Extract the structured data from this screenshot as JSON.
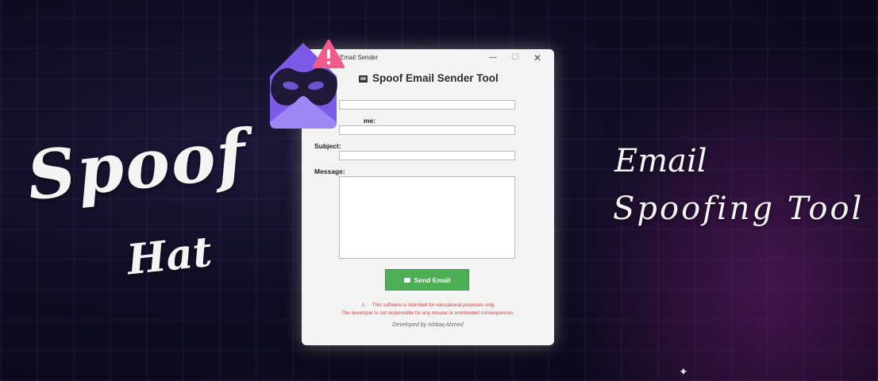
{
  "banner": {
    "brand_line1": "Spoof",
    "brand_line2": "Hat",
    "tagline_line1": "Email",
    "tagline_line2": "Spoofing Tool"
  },
  "window": {
    "title": "Email Sender",
    "minimize_glyph": "—",
    "maximize_glyph": "☐",
    "close_glyph": "✕",
    "app_title": "Spoof Email Sender Tool",
    "fields": {
      "from_name_label": "me:",
      "subject_label": "Subject:",
      "message_label": "Message:"
    },
    "send_button_label": "Send Email",
    "warning_icon": "⚠",
    "warning_line1": "This software is intended for educational purposes only.",
    "warning_line2": "The developer is not responsible for any misuse or unintended consequences.",
    "credit": "Developed by Ishtiaq Ahmed"
  },
  "icons": {
    "mask_envelope": "mask-envelope-icon",
    "alert_badge": "alert-triangle-icon",
    "computer": "computer-icon",
    "mail": "mail-icon",
    "sparkle_glyph": "✦"
  },
  "colors": {
    "send_button": "#4cae55",
    "warning_text": "#e0393e",
    "envelope": "#8b6cf0",
    "alert_badge": "#f25a8c"
  }
}
